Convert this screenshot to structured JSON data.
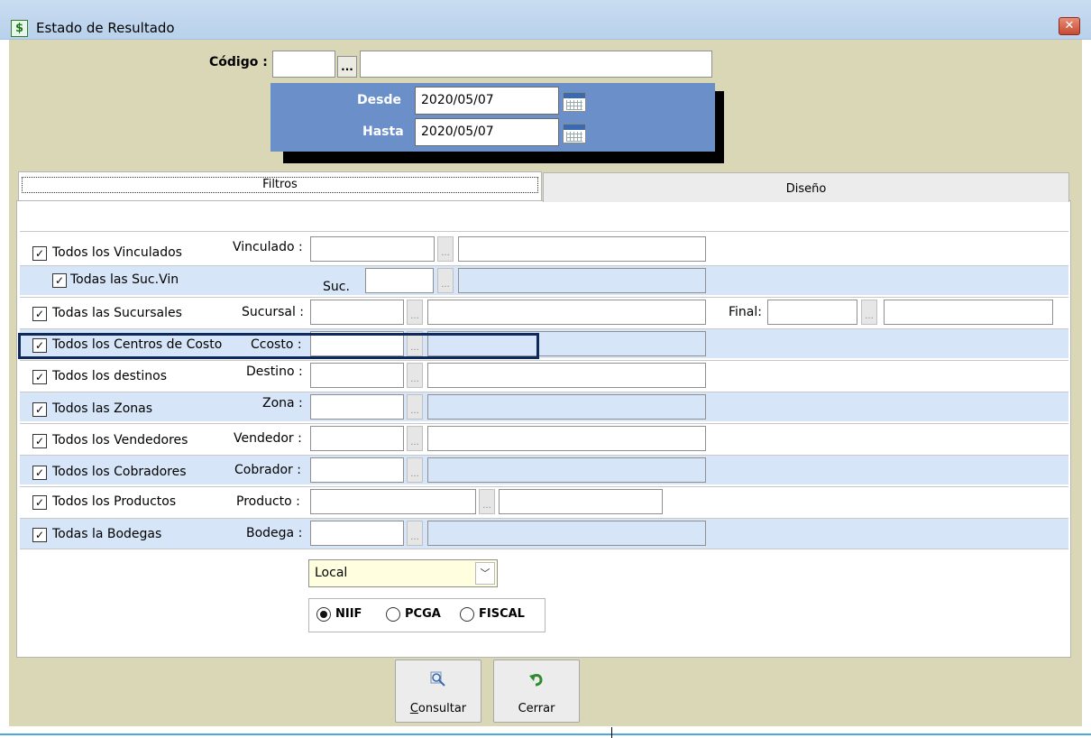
{
  "window": {
    "title": "Estado de Resultado",
    "close_label": "✕",
    "app_icon": "$"
  },
  "header": {
    "codigo_label": "Código :",
    "codigo_value": "",
    "codigo_btn": "...",
    "codigo_desc": "",
    "desde_label": "Desde",
    "desde_value": "2020/05/07",
    "hasta_label": "Hasta",
    "hasta_value": "2020/05/07"
  },
  "tabs": [
    {
      "label": "Filtros",
      "active": true
    },
    {
      "label": "Diseño",
      "active": false
    }
  ],
  "filters": [
    {
      "check": "Todos los Vinculados",
      "field": "Vinculado :",
      "checked": true
    },
    {
      "check": "Todas las Suc.Vin",
      "field": "Suc.",
      "checked": true
    },
    {
      "check": "Todas las Sucursales",
      "field": "Sucursal :",
      "checked": true,
      "extra": "Final:"
    },
    {
      "check": "Todos los Centros de Costo",
      "field": "Ccosto :",
      "checked": true
    },
    {
      "check": "Todos los destinos",
      "field": "Destino :",
      "checked": true
    },
    {
      "check": "Todos las Zonas",
      "field": "Zona :",
      "checked": true
    },
    {
      "check": "Todos los Vendedores",
      "field": "Vendedor :",
      "checked": true
    },
    {
      "check": "Todos los Cobradores",
      "field": "Cobrador :",
      "checked": true
    },
    {
      "check": "Todos los Productos",
      "field": "Producto :",
      "checked": true
    },
    {
      "check": "Todas la Bodegas",
      "field": "Bodega :",
      "checked": true
    }
  ],
  "moneda": {
    "selected": "Local"
  },
  "norma": {
    "options": [
      "NIIF",
      "PCGA",
      "FISCAL"
    ],
    "selected": "NIIF"
  },
  "buttons": {
    "consultar": {
      "label_underline": "C",
      "label_rest": "onsultar",
      "icon": "magnifier-icon"
    },
    "cerrar": {
      "label": "Cerrar",
      "icon": "undo-arrow-icon"
    }
  },
  "icons": {
    "check_mark": "✓",
    "dots": "...",
    "dropdown": "﹀"
  },
  "colors": {
    "panel_bg": "#d9d7b5",
    "date_panel": "#6b8fc9",
    "row_alt": "#d6e5f7",
    "highlight": "#0e2a5c"
  }
}
